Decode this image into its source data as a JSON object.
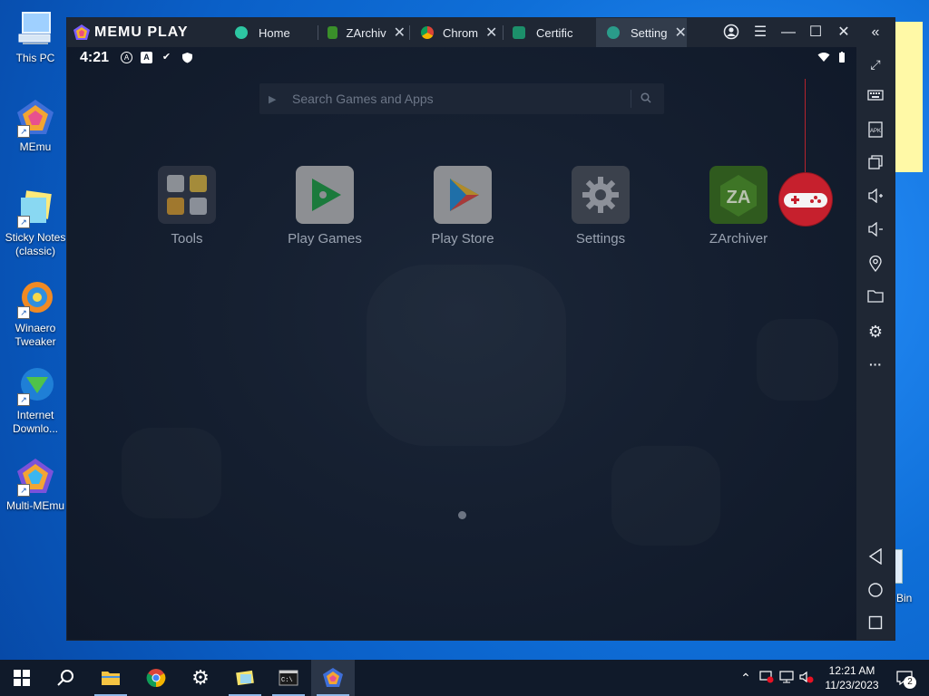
{
  "desktop": {
    "icons": [
      {
        "label": "This PC"
      },
      {
        "label": "MEmu"
      },
      {
        "label": "Sticky Notes (classic)"
      },
      {
        "label": "Winaero Tweaker"
      },
      {
        "label": "Internet Downlo..."
      },
      {
        "label": "Multi-MEmu"
      }
    ],
    "recycle_bin_label": "Bin"
  },
  "memu": {
    "brand": "MEMU PLAY",
    "tabs": [
      {
        "label": "Home",
        "closable": false,
        "active": false
      },
      {
        "label": "ZArchiv",
        "closable": true,
        "active": false
      },
      {
        "label": "Chrom",
        "closable": true,
        "active": false
      },
      {
        "label": "Certific",
        "closable": false,
        "active": false
      },
      {
        "label": "Setting",
        "closable": true,
        "active": true
      }
    ],
    "android": {
      "time": "4:21",
      "search_placeholder": "Search Games and Apps",
      "apps": [
        {
          "label": "Tools"
        },
        {
          "label": "Play Games"
        },
        {
          "label": "Play Store"
        },
        {
          "label": "Settings"
        },
        {
          "label": "ZArchiver"
        }
      ]
    },
    "sidebar_icons": [
      "fullscreen-icon",
      "keyboard-icon",
      "apk-icon",
      "multi-window-icon",
      "volume-up-icon",
      "volume-down-icon",
      "location-icon",
      "folder-icon",
      "settings-icon",
      "more-icon",
      "back-icon",
      "home-icon",
      "recents-icon"
    ],
    "apk_text": "APK"
  },
  "taskbar": {
    "time": "12:21 AM",
    "date": "11/23/2023",
    "notification_count": "2"
  }
}
